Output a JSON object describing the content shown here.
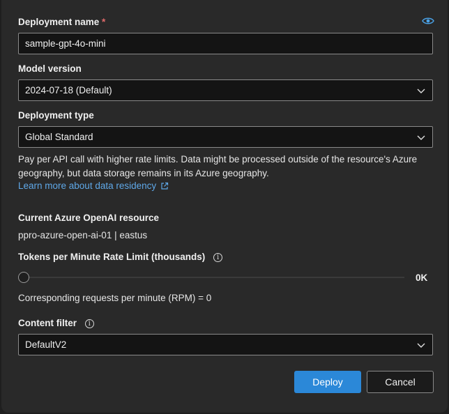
{
  "deployment_name": {
    "label": "Deployment name",
    "required_marker": "*",
    "value": "sample-gpt-4o-mini"
  },
  "model_version": {
    "label": "Model version",
    "selected": "2024-07-18 (Default)"
  },
  "deployment_type": {
    "label": "Deployment type",
    "selected": "Global Standard",
    "description": "Pay per API call with higher rate limits. Data might be processed outside of the resource's Azure geography, but data storage remains in its Azure geography.",
    "link_text": "Learn more about data residency"
  },
  "resource": {
    "label": "Current Azure OpenAI resource",
    "value": "ppro-azure-open-ai-01 | eastus"
  },
  "rate_limit": {
    "label": "Tokens per Minute Rate Limit (thousands)",
    "info_glyph": "i",
    "value_text": "0K",
    "slider_fraction": 0,
    "rpm_text": "Corresponding requests per minute (RPM) = 0"
  },
  "content_filter": {
    "label": "Content filter",
    "info_glyph": "i",
    "selected": "DefaultV2"
  },
  "actions": {
    "deploy_label": "Deploy",
    "cancel_label": "Cancel"
  },
  "colors": {
    "accent": "#2b88d8",
    "link": "#5fa8e8",
    "required": "#e06a6a",
    "panel_bg": "#292929",
    "input_bg": "#141414"
  },
  "icons": {
    "visibility": "eye-icon",
    "external_link": "external-link-icon",
    "dropdown": "chevron-down-icon",
    "info": "info-icon"
  }
}
